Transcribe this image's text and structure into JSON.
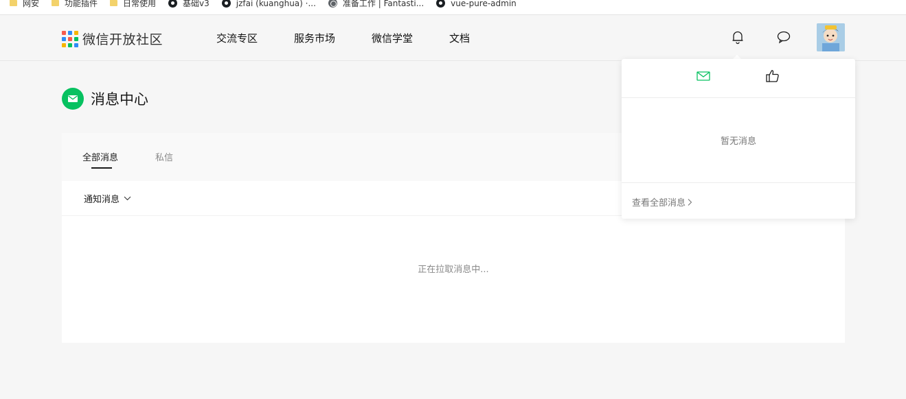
{
  "bookmarks": [
    {
      "label": "网安",
      "icon": "folder-icon"
    },
    {
      "label": "功能插件",
      "icon": "folder-icon"
    },
    {
      "label": "日常使用",
      "icon": "folder-icon"
    },
    {
      "label": "基础v3",
      "icon": "github-icon"
    },
    {
      "label": "jzfai (kuanghua) ·...",
      "icon": "github-icon"
    },
    {
      "label": "准备工作 | Fantasti...",
      "icon": "globe-icon"
    },
    {
      "label": "vue-pure-admin",
      "icon": "github-icon"
    }
  ],
  "header": {
    "logo_text": "微信开放社区",
    "nav": [
      "交流专区",
      "服务市场",
      "微信学堂",
      "文档"
    ]
  },
  "page": {
    "title": "消息中心"
  },
  "panel": {
    "tabs": [
      "全部消息",
      "私信"
    ],
    "filter_label": "通知消息",
    "loading_text": "正在拉取消息中..."
  },
  "dropdown": {
    "empty_text": "暂无消息",
    "view_all": "查看全部消息"
  },
  "colors": {
    "accent": "#07c160",
    "background": "#f6f6f6",
    "panel": "#ffffff"
  }
}
